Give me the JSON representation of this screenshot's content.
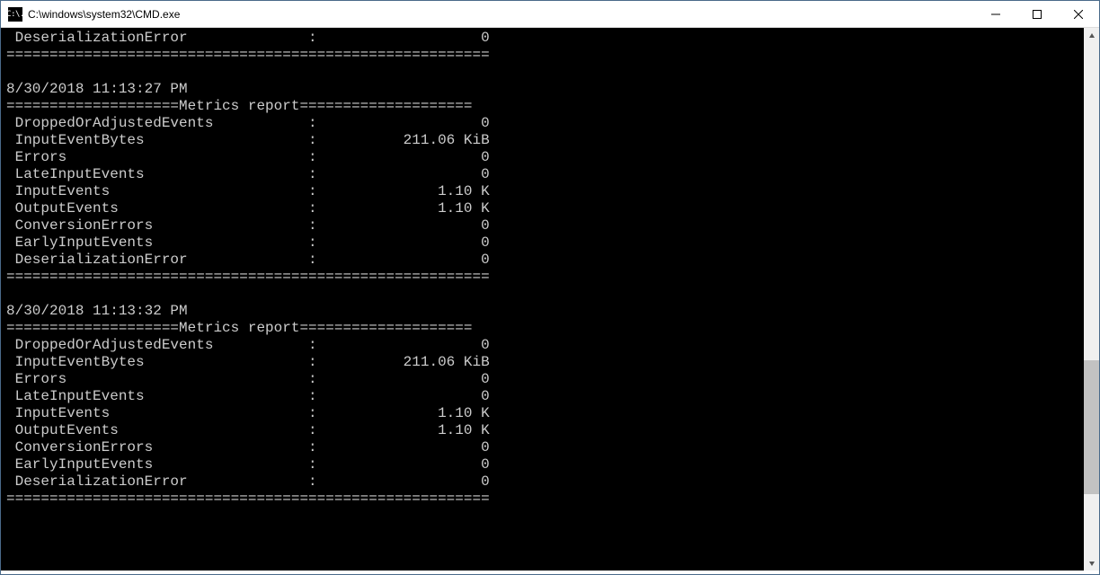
{
  "window": {
    "title": "C:\\windows\\system32\\CMD.exe",
    "icon_text": "C:\\."
  },
  "divider_row": "========================================================",
  "header_prefix": "====================",
  "header_label": "Metrics report",
  "header_suffix": "====================",
  "top_fragment": {
    "metric": "DeserializationError",
    "value": "0"
  },
  "reports": [
    {
      "timestamp": "8/30/2018 11:13:27 PM",
      "rows": [
        {
          "metric": "DroppedOrAdjustedEvents",
          "value": "0"
        },
        {
          "metric": "InputEventBytes",
          "value": "211.06 KiB"
        },
        {
          "metric": "Errors",
          "value": "0"
        },
        {
          "metric": "LateInputEvents",
          "value": "0"
        },
        {
          "metric": "InputEvents",
          "value": "1.10 K"
        },
        {
          "metric": "OutputEvents",
          "value": "1.10 K"
        },
        {
          "metric": "ConversionErrors",
          "value": "0"
        },
        {
          "metric": "EarlyInputEvents",
          "value": "0"
        },
        {
          "metric": "DeserializationError",
          "value": "0"
        }
      ]
    },
    {
      "timestamp": "8/30/2018 11:13:32 PM",
      "rows": [
        {
          "metric": "DroppedOrAdjustedEvents",
          "value": "0"
        },
        {
          "metric": "InputEventBytes",
          "value": "211.06 KiB"
        },
        {
          "metric": "Errors",
          "value": "0"
        },
        {
          "metric": "LateInputEvents",
          "value": "0"
        },
        {
          "metric": "InputEvents",
          "value": "1.10 K"
        },
        {
          "metric": "OutputEvents",
          "value": "1.10 K"
        },
        {
          "metric": "ConversionErrors",
          "value": "0"
        },
        {
          "metric": "EarlyInputEvents",
          "value": "0"
        },
        {
          "metric": "DeserializationError",
          "value": "0"
        }
      ]
    }
  ],
  "layout": {
    "name_col_width": 34,
    "value_col_width": 20
  }
}
